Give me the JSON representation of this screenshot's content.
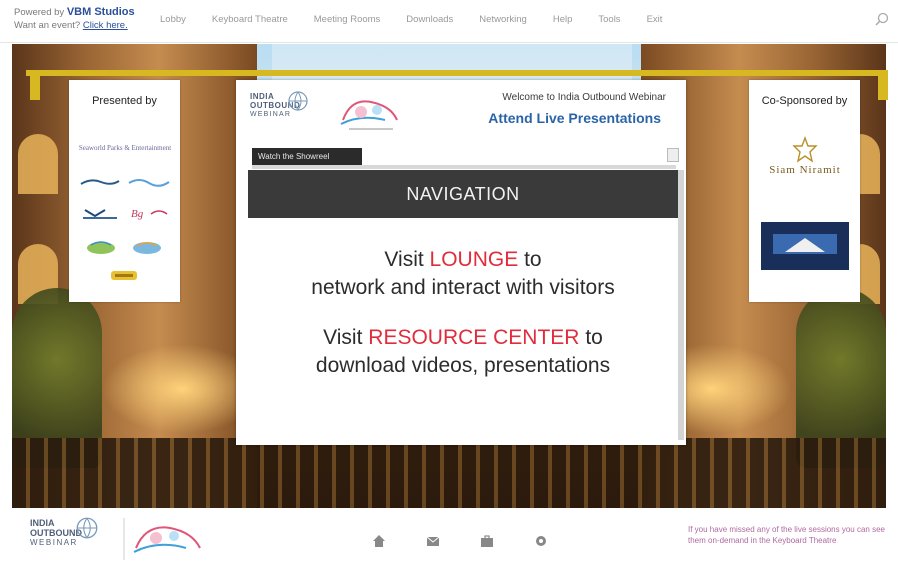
{
  "topbar": {
    "powered_prefix": "Powered by",
    "powered_brand": "VBM Studios",
    "event_prefix": "Want an event?",
    "event_link": "Click here.",
    "menu": [
      "Lobby",
      "Keyboard Theatre",
      "Meeting Rooms",
      "Downloads",
      "Networking",
      "Help",
      "Tools",
      "Exit"
    ]
  },
  "left_panel": {
    "title": "Presented by",
    "logos": [
      "Seaworld Parks & Entertainment",
      "SeaWorld",
      "Aquatica",
      "SeaWorld",
      "Busch Gardens",
      "Adventure Island",
      "Water Country",
      "Sesame Place"
    ]
  },
  "right_panel": {
    "title": "Co-Sponsored by",
    "logos": [
      "Siam Niramit",
      "Imagination Inc"
    ]
  },
  "center": {
    "logo_line1": "INDIA",
    "logo_line2": "OUTBOUND",
    "logo_line3": "WEBINAR",
    "welcome": "Welcome to India Outbound Webinar",
    "attend": "Attend Live Presentations",
    "tab_label": "Watch the Showreel",
    "nav_title": "NAVIGATION",
    "lounge_pre": "Visit ",
    "lounge_word": "LOUNGE",
    "lounge_post": " to",
    "lounge_desc": "network and interact with visitors",
    "resource_pre": "Visit ",
    "resource_word": "RESOURCE CENTER",
    "resource_post": " to",
    "resource_desc": "download videos, presentations"
  },
  "footer": {
    "logo_line1": "INDIA",
    "logo_line2": "OUTBOUND",
    "logo_line3": "WEBINAR",
    "icons": [
      "home-icon",
      "mail-icon",
      "briefcase-icon",
      "gear-icon"
    ],
    "note": "If you have missed any of the live sessions you can see them on-demand in the Keyboard Theatre"
  },
  "colors": {
    "accent_red": "#e12c3c",
    "link_blue": "#2a64a8",
    "rail_gold": "#d8b820"
  }
}
